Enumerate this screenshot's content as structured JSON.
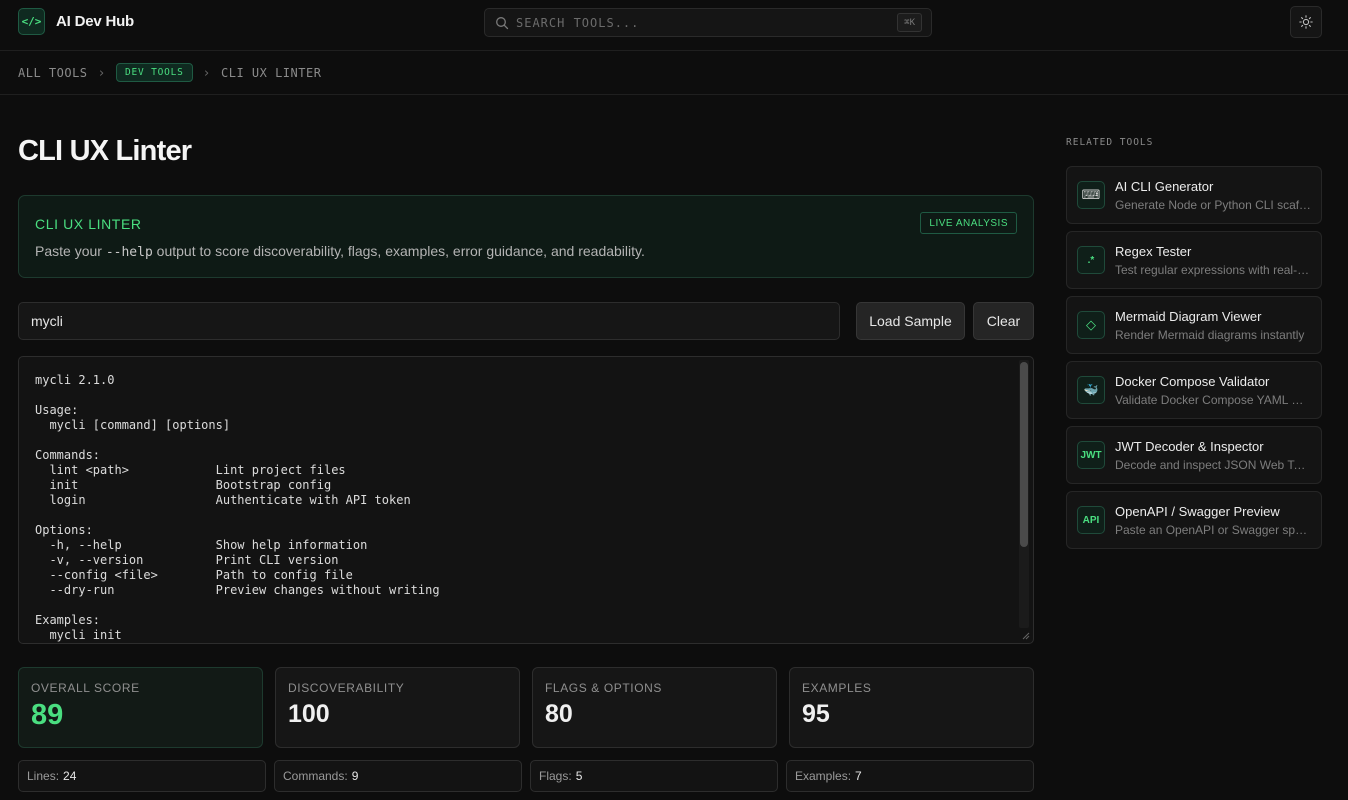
{
  "header": {
    "logo_text": "</>",
    "app_title": "AI Dev Hub",
    "search_placeholder": "SEARCH TOOLS...",
    "search_shortcut": "⌘K",
    "theme_toggle_icon": "sun-icon"
  },
  "breadcrumb": {
    "root": "ALL TOOLS",
    "category": "DEV TOOLS",
    "current": "CLI UX LINTER"
  },
  "main": {
    "page_title": "CLI UX Linter",
    "banner": {
      "title": "CLI UX LINTER",
      "badge": "LIVE ANALYSIS",
      "desc_before": "Paste your ",
      "desc_code": "--help",
      "desc_after": " output to score discoverability, flags, examples, error guidance, and readability."
    },
    "cli_name_value": "mycli",
    "load_sample_label": "Load Sample",
    "clear_label": "Clear",
    "help_text": "mycli 2.1.0\n\nUsage:\n  mycli [command] [options]\n\nCommands:\n  lint <path>            Lint project files\n  init                   Bootstrap config\n  login                  Authenticate with API token\n\nOptions:\n  -h, --help             Show help information\n  -v, --version          Print CLI version\n  --config <file>        Path to config file\n  --dry-run              Preview changes without writing\n\nExamples:\n  mycli init",
    "scores": [
      {
        "label": "OVERALL SCORE",
        "value": "89"
      },
      {
        "label": "DISCOVERABILITY",
        "value": "100"
      },
      {
        "label": "FLAGS & OPTIONS",
        "value": "80"
      },
      {
        "label": "EXAMPLES",
        "value": "95"
      }
    ],
    "stats": [
      {
        "label": "Lines:",
        "value": "24"
      },
      {
        "label": "Commands:",
        "value": "9"
      },
      {
        "label": "Flags:",
        "value": "5"
      },
      {
        "label": "Examples:",
        "value": "7"
      }
    ]
  },
  "related": {
    "heading": "RELATED TOOLS",
    "tools": [
      {
        "name": "AI CLI Generator",
        "desc": "Generate Node or Python CLI scaffolds",
        "icon": "keyboard-icon",
        "glyph": "⌨"
      },
      {
        "name": "Regex Tester",
        "desc": "Test regular expressions with real-time matching",
        "icon": "regex-icon",
        "glyph": ".*"
      },
      {
        "name": "Mermaid Diagram Viewer",
        "desc": "Render Mermaid diagrams instantly",
        "icon": "diamond-icon",
        "glyph": "◇"
      },
      {
        "name": "Docker Compose Validator",
        "desc": "Validate Docker Compose YAML with rules",
        "icon": "whale-icon",
        "glyph": "🐳"
      },
      {
        "name": "JWT Decoder & Inspector",
        "desc": "Decode and inspect JSON Web Tokens",
        "icon": "jwt-icon",
        "glyph": "JWT"
      },
      {
        "name": "OpenAPI / Swagger Preview",
        "desc": "Paste an OpenAPI or Swagger spec to preview",
        "icon": "api-icon",
        "glyph": "API"
      }
    ]
  },
  "colors": {
    "accent": "#4ade80",
    "background": "#0d0d0d",
    "surface": "#161616"
  }
}
